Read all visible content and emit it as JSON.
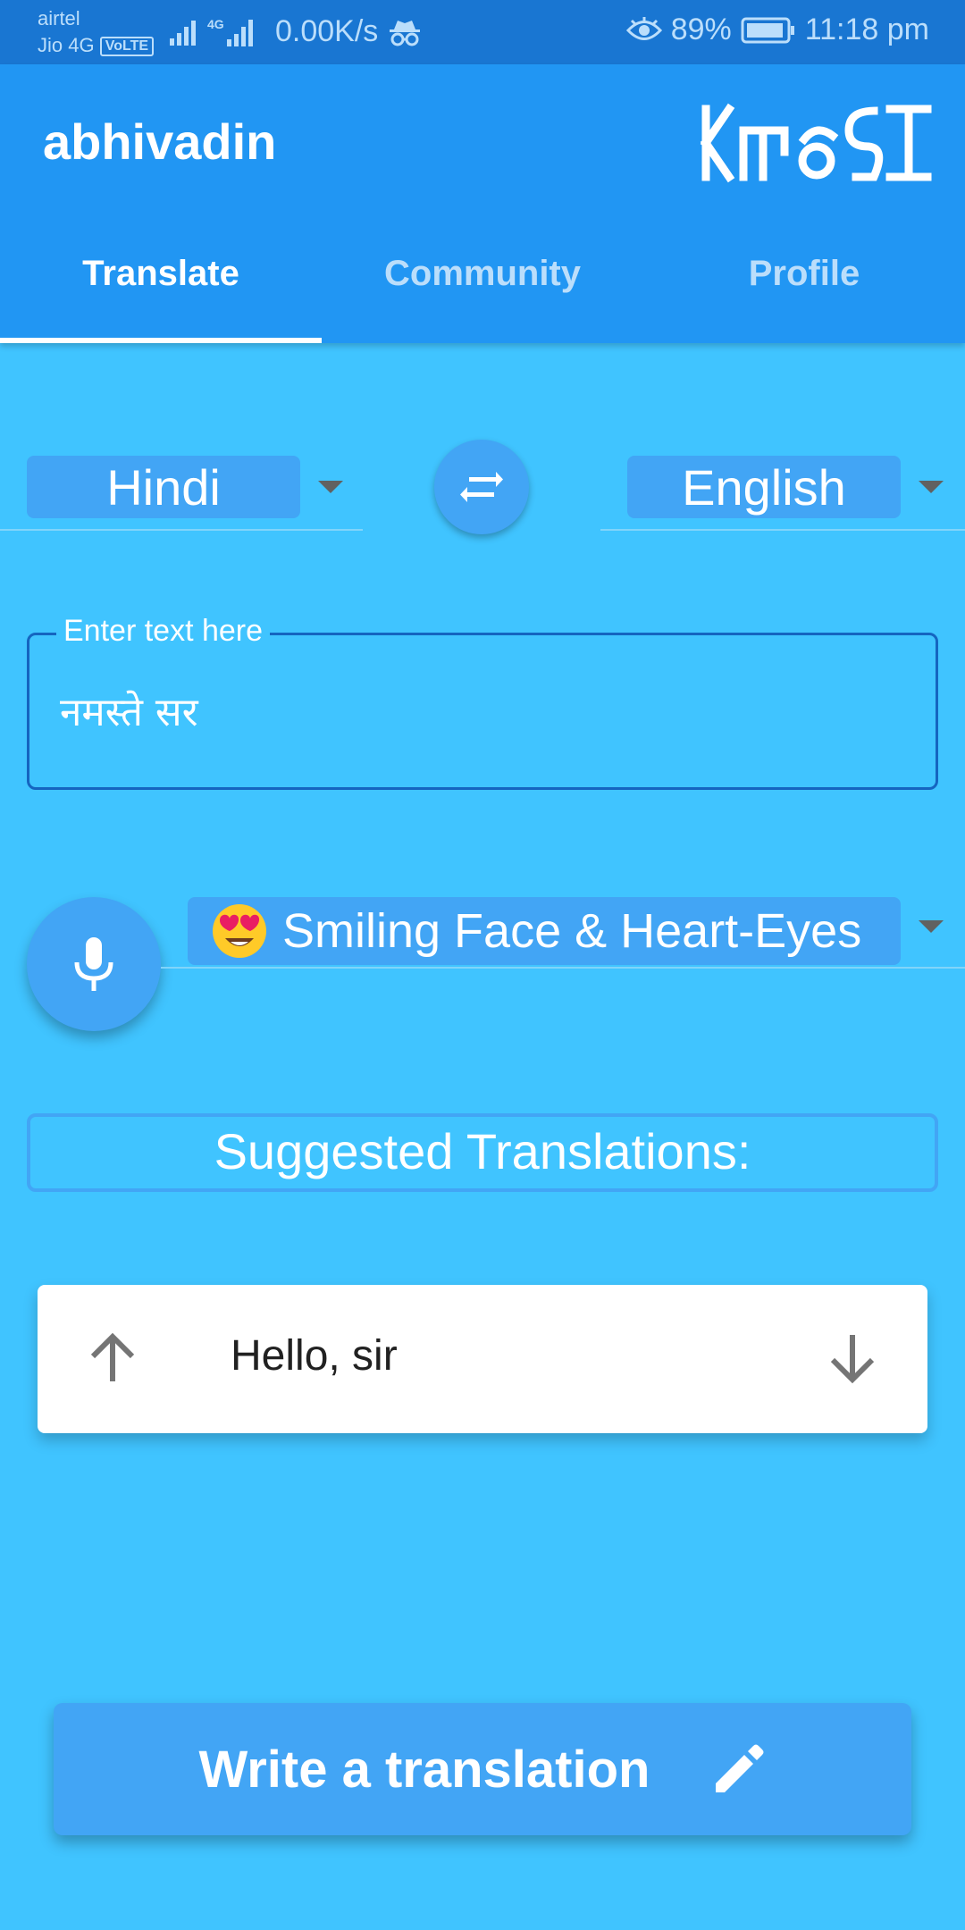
{
  "status_bar": {
    "carrier1": "airtel",
    "carrier2": "Jio 4G",
    "volte": "VoLTE",
    "network_type": "4G",
    "speed": "0.00K/s",
    "battery": "89%",
    "time": "11:18 pm",
    "icons": [
      "signal-icon",
      "signal-4g-icon",
      "incognito-icon",
      "eye-icon",
      "battery-icon"
    ]
  },
  "app": {
    "title": "abhivadin",
    "logo_icon": "abhivadin-script-logo",
    "accent": "#2196F3",
    "background": "#40C4FF"
  },
  "tabs": [
    {
      "label": "Translate",
      "active": true
    },
    {
      "label": "Community",
      "active": false
    },
    {
      "label": "Profile",
      "active": false
    }
  ],
  "translate": {
    "source_language": "Hindi",
    "target_language": "English",
    "swap_icon": "swap-horizontal-icon",
    "input_label": "Enter text here",
    "input_value": "नमस्ते सर",
    "mic_icon": "microphone-icon",
    "emotion_emoji": "😍",
    "emotion_label": "Smiling Face & Heart-Eyes",
    "suggested_header": "Suggested Translations:",
    "suggestions": [
      {
        "text": "Hello, sir"
      }
    ],
    "write_button": "Write a translation",
    "write_icon": "pencil-icon"
  }
}
